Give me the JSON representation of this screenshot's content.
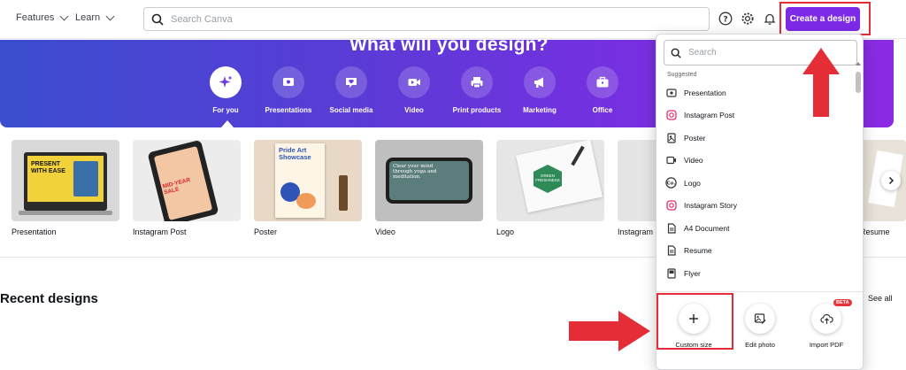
{
  "nav": {
    "features_label": "Features",
    "learn_label": "Learn",
    "search_placeholder": "Search Canva",
    "create_button_label": "Create a design"
  },
  "icons": {
    "help": "help-icon",
    "settings": "gear-icon",
    "notifications": "bell-icon"
  },
  "hero": {
    "title": "What will you design?",
    "categories": [
      {
        "label": "For you",
        "icon": "sparkle-icon",
        "active": true
      },
      {
        "label": "Presentations",
        "icon": "presentation-icon"
      },
      {
        "label": "Social media",
        "icon": "heart-chat-icon"
      },
      {
        "label": "Video",
        "icon": "video-camera-icon"
      },
      {
        "label": "Print products",
        "icon": "printer-icon"
      },
      {
        "label": "Marketing",
        "icon": "megaphone-icon"
      },
      {
        "label": "Office",
        "icon": "briefcase-icon"
      }
    ]
  },
  "templates": [
    {
      "caption": "Presentation",
      "thumb_text": "PRESENT WITH EASE"
    },
    {
      "caption": "Instagram Post",
      "thumb_text": "MID-YEAR SALE"
    },
    {
      "caption": "Poster",
      "thumb_text": "Pride Art Showcase"
    },
    {
      "caption": "Video",
      "thumb_text": "Clear your mind through yoga and meditation."
    },
    {
      "caption": "Logo",
      "thumb_text": "GREEN FRESHNESS"
    },
    {
      "caption": "Instagram"
    },
    {
      "caption": "Resume"
    }
  ],
  "recent": {
    "title": "Recent designs",
    "see_all_label": "See all"
  },
  "dropdown": {
    "search_placeholder": "Search",
    "section_label": "Suggested",
    "items": [
      {
        "label": "Presentation",
        "icon": "presentation-icon"
      },
      {
        "label": "Instagram Post",
        "icon": "instagram-icon"
      },
      {
        "label": "Poster",
        "icon": "poster-icon"
      },
      {
        "label": "Video",
        "icon": "video-icon"
      },
      {
        "label": "Logo",
        "icon": "logo-co-icon"
      },
      {
        "label": "Instagram Story",
        "icon": "instagram-icon"
      },
      {
        "label": "A4 Document",
        "icon": "document-icon"
      },
      {
        "label": "Resume",
        "icon": "document-icon"
      },
      {
        "label": "Flyer",
        "icon": "flyer-icon"
      }
    ],
    "actions": [
      {
        "label": "Custom size",
        "icon": "plus-icon"
      },
      {
        "label": "Edit photo",
        "icon": "image-edit-icon"
      },
      {
        "label": "Import PDF",
        "icon": "upload-cloud-icon",
        "badge": "BETA"
      }
    ]
  },
  "colors": {
    "accent": "#7d2ae8",
    "annotation_red": "#e52d38",
    "instagram": "#e1306c"
  }
}
